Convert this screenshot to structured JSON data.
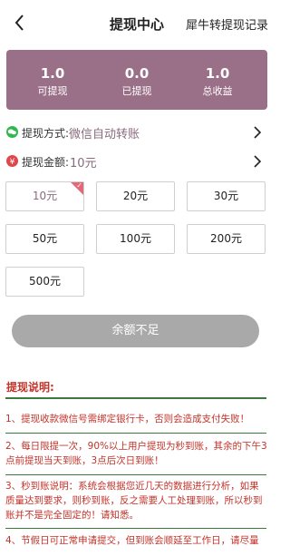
{
  "navbar": {
    "title": "提现中心",
    "right_link": "犀牛转提现记录"
  },
  "summary": {
    "accent_color": "#9a7088",
    "stats": [
      {
        "value": "1.0",
        "label": "可提现"
      },
      {
        "value": "0.0",
        "label": "已提现"
      },
      {
        "value": "1.0",
        "label": "总收益"
      }
    ]
  },
  "method": {
    "label": "提现方式:",
    "value": "微信自动转账",
    "icon": "wechat-icon"
  },
  "amount": {
    "label": "提现金额:",
    "value": "10元",
    "icon": "yen-icon"
  },
  "amount_options": [
    {
      "label": "10元",
      "selected": true
    },
    {
      "label": "20元",
      "selected": false
    },
    {
      "label": "30元",
      "selected": false
    },
    {
      "label": "50元",
      "selected": false
    },
    {
      "label": "100元",
      "selected": false
    },
    {
      "label": "200元",
      "selected": false
    },
    {
      "label": "500元",
      "selected": false
    }
  ],
  "submit_label": "余额不足",
  "notes": {
    "title": "提现说明:",
    "items": [
      "1、提现收款微信号需绑定银行卡，否则会造成支付失败！",
      "2、每日限提一次，90%以上用户提现为秒到账，其余的下午3点前提现当天到账，3点后次日到账！",
      "3、秒到账说明：系统会根据您近几天的数据进行分析，如果质量达到要求，则秒到账，反之需要人工处理到账，所以秒到账并不是完全固定的！请知悉。",
      "4、节假日可正常申请提交，但到账会顺延至工作日，请尽量"
    ]
  }
}
